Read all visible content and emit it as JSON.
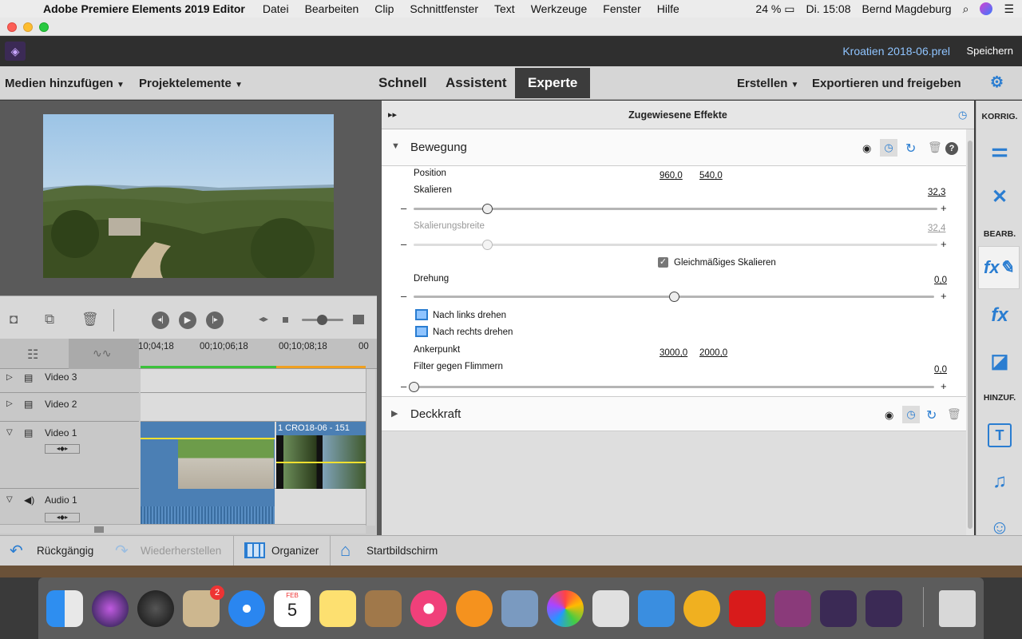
{
  "menubar": {
    "app": "Adobe Premiere Elements 2019 Editor",
    "items": [
      "Datei",
      "Bearbeiten",
      "Clip",
      "Schnittfenster",
      "Text",
      "Werkzeuge",
      "Fenster",
      "Hilfe"
    ],
    "battery": "24 %",
    "clock": "Di. 15:08",
    "user": "Bernd Magdeburg"
  },
  "appbar": {
    "project": "Kroatien 2018-06.prel",
    "save": "Speichern"
  },
  "toolbar": {
    "add_media": "Medien hinzufügen",
    "project_elements": "Projektelemente",
    "tabs": [
      "Schnell",
      "Assistent",
      "Experte"
    ],
    "create": "Erstellen",
    "export": "Exportieren und freigeben"
  },
  "timeline": {
    "timecodes": [
      "10;04;18",
      "00;10;06;18",
      "00;10;08;18",
      "00"
    ],
    "tracks": [
      "Video 3",
      "Video 2",
      "Video 1",
      "Audio 1"
    ],
    "clip_label": "1 CRO18-06  - 151"
  },
  "fx": {
    "header": "Zugewiesene Effekte",
    "motion": "Bewegung",
    "position_label": "Position",
    "position_x": "960,0",
    "position_y": "540,0",
    "scale_label": "Skalieren",
    "scale_value": "32,3",
    "scale_width_label": "Skalierungsbreite",
    "scale_width_value": "32,4",
    "uniform_scale": "Gleichmäßiges Skalieren",
    "rotation_label": "Drehung",
    "rotation_value": "0,0",
    "rotate_left": "Nach links drehen",
    "rotate_right": "Nach rechts drehen",
    "anchor_label": "Ankerpunkt",
    "anchor_x": "3000,0",
    "anchor_y": "2000,0",
    "flicker_label": "Filter gegen Flimmern",
    "flicker_value": "0,0",
    "opacity": "Deckkraft",
    "sliders": {
      "scale": 0.14,
      "scale_width": 0.14,
      "rotation": 0.5,
      "flicker": 0.0
    }
  },
  "sidebar": {
    "korrig": "KORRIG.",
    "bearb": "BEARB.",
    "hinzuf": "HINZUF."
  },
  "bottombar": {
    "undo": "Rückgängig",
    "redo": "Wiederherstellen",
    "organizer": "Organizer",
    "home": "Startbildschirm"
  },
  "dock": {
    "mail_badge": "2",
    "calendar_month": "FEB",
    "calendar_day": "5"
  }
}
